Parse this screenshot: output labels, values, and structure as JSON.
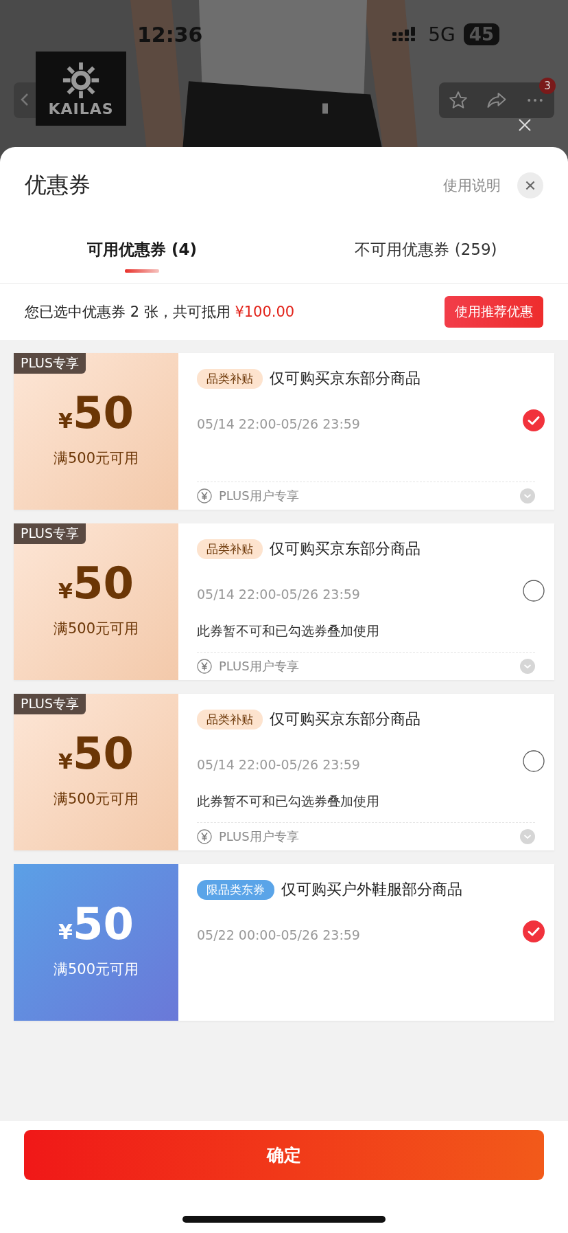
{
  "status_bar": {
    "time": "12:36",
    "network": "5G",
    "battery": "45"
  },
  "store_logo": {
    "text": "KAILAS"
  },
  "nav": {
    "more_badge": "3"
  },
  "sheet": {
    "title": "优惠券",
    "help_link": "使用说明"
  },
  "tabs": [
    {
      "label": "可用优惠券 (4)",
      "selected": true
    },
    {
      "label": "不可用优惠券 (259)",
      "selected": false
    }
  ],
  "summary": {
    "text": "您已选中优惠券 2 张，共可抵用",
    "amount": "¥100.00",
    "button": "使用推荐优惠"
  },
  "coupons": [
    {
      "kind": "plus",
      "badge": "PLUS专享",
      "currency": "¥",
      "amount": "50",
      "condition": "满500元可用",
      "tag": "品类补贴",
      "title": "仅可购买京东部分商品",
      "validity": "05/14 22:00-05/26 23:59",
      "footer": "PLUS用户专享",
      "selected": true
    },
    {
      "kind": "plus",
      "badge": "PLUS专享",
      "currency": "¥",
      "amount": "50",
      "condition": "满500元可用",
      "tag": "品类补贴",
      "title": "仅可购买京东部分商品",
      "validity": "05/14 22:00-05/26 23:59",
      "note": "此券暂不可和已勾选券叠加使用",
      "footer": "PLUS用户专享",
      "selected": false
    },
    {
      "kind": "plus",
      "badge": "PLUS专享",
      "currency": "¥",
      "amount": "50",
      "condition": "满500元可用",
      "tag": "品类补贴",
      "title": "仅可购买京东部分商品",
      "validity": "05/14 22:00-05/26 23:59",
      "note": "此券暂不可和已勾选券叠加使用",
      "footer": "PLUS用户专享",
      "selected": false
    },
    {
      "kind": "category",
      "currency": "¥",
      "amount": "50",
      "condition": "满500元可用",
      "tag": "限品类东券",
      "title": "仅可购买户外鞋服部分商品",
      "validity": "05/22 00:00-05/26 23:59",
      "selected": true
    }
  ],
  "confirm_button": "确定"
}
